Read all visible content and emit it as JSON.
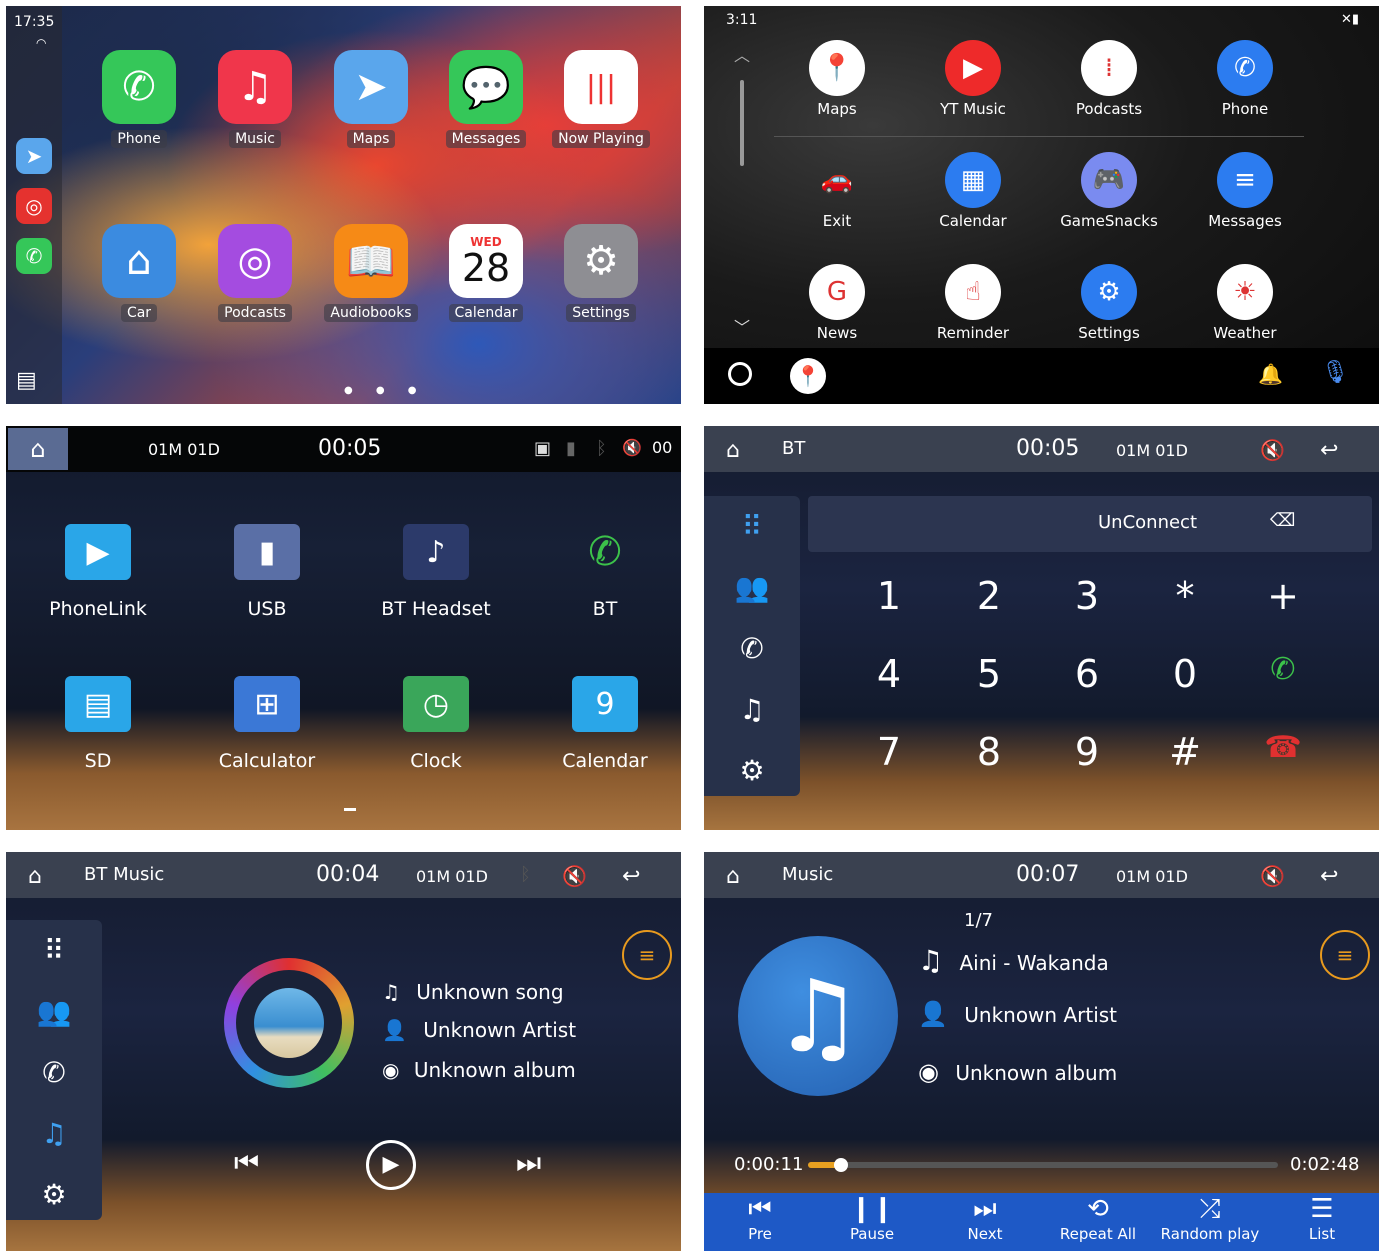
{
  "carplay": {
    "time": "17:35",
    "apps": [
      {
        "label": "Phone",
        "color": "#35c759",
        "icon": "✆"
      },
      {
        "label": "Music",
        "color": "#f0364b",
        "icon": "♫"
      },
      {
        "label": "Maps",
        "color": "#5aa6ec",
        "icon": "➤"
      },
      {
        "label": "Messages",
        "color": "#35c759",
        "icon": "💬"
      },
      {
        "label": "Now Playing",
        "color": "#ffffff",
        "icon": "|||"
      },
      {
        "label": "Car",
        "color": "#3b8be0",
        "icon": "⌂"
      },
      {
        "label": "Podcasts",
        "color": "#a44ce0",
        "icon": "◎"
      },
      {
        "label": "Audiobooks",
        "color": "#f68a16",
        "icon": "📖"
      },
      {
        "label": "Calendar",
        "color": "#ffffff",
        "icon": "28"
      },
      {
        "label": "Settings",
        "color": "#8e8e93",
        "icon": "⚙"
      }
    ],
    "calendar_day": "WED",
    "calendar_date": "28"
  },
  "android_auto": {
    "time": "3:11",
    "apps": [
      {
        "label": "Maps",
        "color": "#ffffff",
        "icon": "📍"
      },
      {
        "label": "YT Music",
        "color": "#ee2a2a",
        "icon": "▶"
      },
      {
        "label": "Podcasts",
        "color": "#ffffff",
        "icon": "⁞"
      },
      {
        "label": "Phone",
        "color": "#2c7cf0",
        "icon": "✆"
      },
      {
        "label": "Exit",
        "color": "transparent",
        "icon": "🚗"
      },
      {
        "label": "Calendar",
        "color": "#2c7cf0",
        "icon": "▦"
      },
      {
        "label": "GameSnacks",
        "color": "#7a8bf0",
        "icon": "🎮"
      },
      {
        "label": "Messages",
        "color": "#2c7cf0",
        "icon": "≡"
      },
      {
        "label": "News",
        "color": "#ffffff",
        "icon": "G"
      },
      {
        "label": "Reminder",
        "color": "#ffffff",
        "icon": "☝"
      },
      {
        "label": "Settings",
        "color": "#2c7cf0",
        "icon": "⚙"
      },
      {
        "label": "Weather",
        "color": "#ffffff",
        "icon": "☀"
      }
    ]
  },
  "home": {
    "date": "01M 01D",
    "time": "00:05",
    "volume": "00",
    "apps": [
      {
        "label": "PhoneLink",
        "color": "#2aa6e8",
        "icon": "▶"
      },
      {
        "label": "USB",
        "color": "#5a6fa6",
        "icon": "▮"
      },
      {
        "label": "BT Headset",
        "color": "#2c3a6a",
        "icon": "♪"
      },
      {
        "label": "BT",
        "color": "transparent",
        "icon": "✆"
      },
      {
        "label": "SD",
        "color": "#2aa6e8",
        "icon": "▤"
      },
      {
        "label": "Calculator",
        "color": "#3b78d6",
        "icon": "⊞"
      },
      {
        "label": "Clock",
        "color": "#3aa65a",
        "icon": "◷"
      },
      {
        "label": "Calendar",
        "color": "#2aa6e8",
        "icon": "9"
      }
    ]
  },
  "bt_dialer": {
    "title": "BT",
    "time": "00:05",
    "date": "01M 01D",
    "status": "UnConnect",
    "keys": [
      "1",
      "2",
      "3",
      "*",
      "+",
      "4",
      "5",
      "6",
      "0",
      "✆",
      "7",
      "8",
      "9",
      "#",
      "☎"
    ]
  },
  "bt_music": {
    "title": "BT Music",
    "time": "00:04",
    "date": "01M 01D",
    "song": "Unknown song",
    "artist": "Unknown Artist",
    "album": "Unknown album"
  },
  "music": {
    "title": "Music",
    "time": "00:07",
    "date": "01M 01D",
    "track_index": "1/7",
    "song": "Aini - Wakanda",
    "artist": "Unknown Artist",
    "album": "Unknown album",
    "elapsed": "0:00:11",
    "duration": "0:02:48",
    "progress": 0.07,
    "controls": [
      "Pre",
      "Pause",
      "Next",
      "Repeat All",
      "Random play",
      "List"
    ],
    "control_icons": [
      "⏮",
      "❙❙",
      "⏭",
      "⟲",
      "⤮",
      "☰"
    ]
  }
}
